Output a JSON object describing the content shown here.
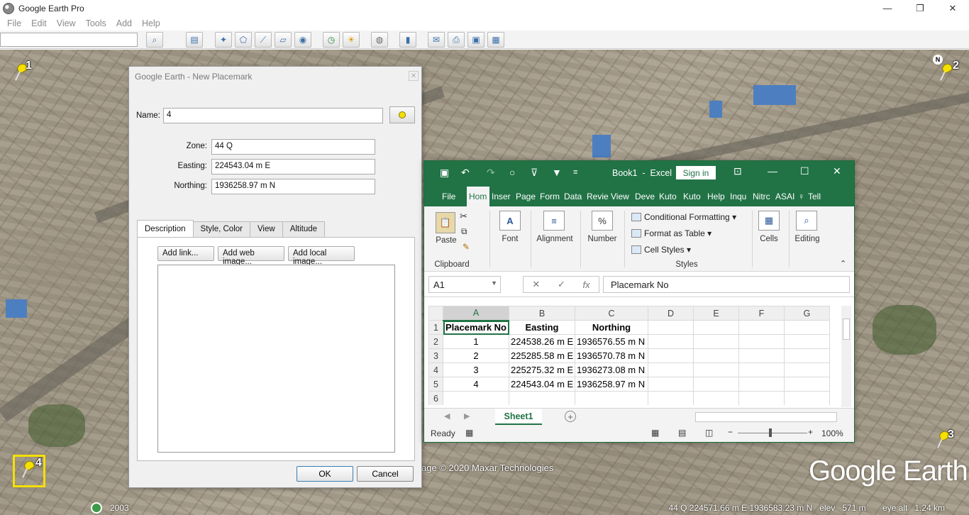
{
  "ge": {
    "window_title": "Google Earth Pro",
    "menu": [
      "File",
      "Edit",
      "View",
      "Tools",
      "Add",
      "Help"
    ],
    "pins": [
      {
        "label": "1"
      },
      {
        "label": "2"
      },
      {
        "label": "3"
      },
      {
        "label": "4"
      }
    ],
    "north": "N",
    "imagery_credit": "age © 2020 Maxar Technologies",
    "logo": "Google Earth",
    "status": {
      "year": "2003",
      "coords": "44 Q 224571.66 m E 1936583.23 m N   elev   571 m       eye alt   1.24 km"
    }
  },
  "placemark_dialog": {
    "title": "Google Earth - New Placemark",
    "name_label": "Name:",
    "name_value": "4",
    "zone_label": "Zone:",
    "zone_value": "44 Q",
    "easting_label": "Easting:",
    "easting_value": "224543.04 m E",
    "northing_label": "Northing:",
    "northing_value": "1936258.97 m N",
    "tabs": [
      "Description",
      "Style, Color",
      "View",
      "Altitude"
    ],
    "add_link": "Add link...",
    "add_web_image": "Add web image...",
    "add_local_image": "Add local image...",
    "ok": "OK",
    "cancel": "Cancel"
  },
  "excel": {
    "book_title": "Book1  -  Excel",
    "sign_in": "Sign in",
    "tabs": [
      "File",
      "Hom",
      "Inser",
      "Page",
      "Form",
      "Data",
      "Revie",
      "View",
      "Deve",
      "Kuto",
      "Kuto",
      "Help",
      "Inqu",
      "Nitrc",
      "ASAI",
      "Tell"
    ],
    "ribbon": {
      "paste": "Paste",
      "clipboard": "Clipboard",
      "font": "Font",
      "alignment": "Alignment",
      "number": "Number",
      "conditional_formatting": "Conditional Formatting",
      "format_as_table": "Format as Table",
      "cell_styles": "Cell Styles",
      "styles": "Styles",
      "cells": "Cells",
      "editing": "Editing"
    },
    "name_box": "A1",
    "formula": "Placemark No",
    "columns": [
      "A",
      "B",
      "C",
      "D",
      "E",
      "F",
      "G"
    ],
    "header_row": [
      "Placemark No",
      "Easting",
      "Northing"
    ],
    "rows": [
      [
        "1",
        "224538.26 m E",
        "1936576.55 m N"
      ],
      [
        "2",
        "225285.58 m E",
        "1936570.78 m N"
      ],
      [
        "3",
        "225275.32 m E",
        "1936273.08 m N"
      ],
      [
        "4",
        "224543.04 m E",
        "1936258.97 m N"
      ]
    ],
    "sheet_tab": "Sheet1",
    "status_ready": "Ready",
    "zoom": "100%"
  }
}
